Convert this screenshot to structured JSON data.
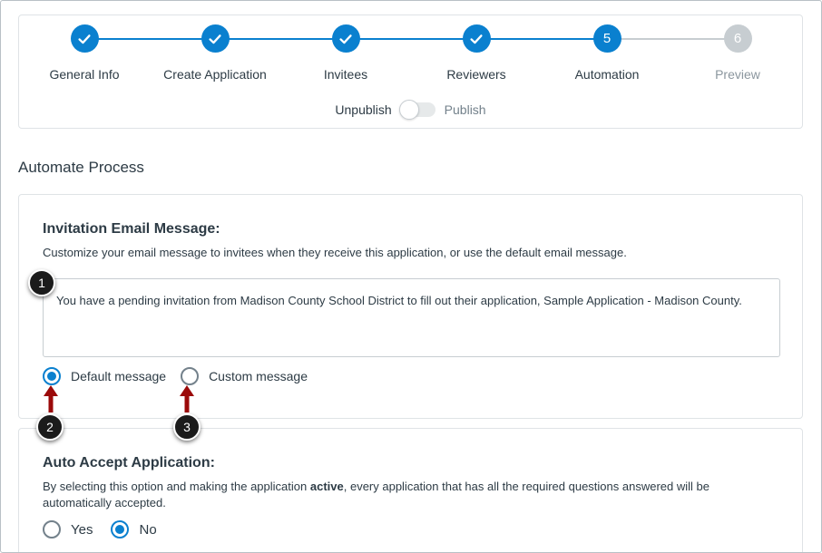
{
  "stepper": {
    "steps": [
      {
        "label": "General Info",
        "status": "complete",
        "number": "1"
      },
      {
        "label": "Create Application",
        "status": "complete",
        "number": "2"
      },
      {
        "label": "Invitees",
        "status": "complete",
        "number": "3"
      },
      {
        "label": "Reviewers",
        "status": "complete",
        "number": "4"
      },
      {
        "label": "Automation",
        "status": "current",
        "number": "5"
      },
      {
        "label": "Preview",
        "status": "pending",
        "number": "6"
      }
    ],
    "accent_color": "#0a80cf",
    "pending_color": "#c7cdd1",
    "publish_toggle": {
      "off_label": "Unpublish",
      "on_label": "Publish",
      "state": "off"
    }
  },
  "section_title": "Automate Process",
  "invitation": {
    "heading": "Invitation Email Message:",
    "description": "Customize your email message to invitees when they receive this application, or use the default email message.",
    "message_value": "You have a pending invitation from Madison County School District to fill out their application, Sample Application - Madison County.",
    "options": [
      {
        "label": "Default message",
        "checked": true
      },
      {
        "label": "Custom message",
        "checked": false
      }
    ]
  },
  "auto_accept": {
    "heading": "Auto Accept Application:",
    "description_before": "By selecting this option and making the application ",
    "description_bold": "active",
    "description_after": ", every application that has all the required questions answered will be automatically accepted.",
    "options": [
      {
        "label": "Yes",
        "checked": false
      },
      {
        "label": "No",
        "checked": true
      }
    ]
  },
  "callouts": [
    "1",
    "2",
    "3"
  ],
  "callout_arrow_color": "#9b0a0a"
}
